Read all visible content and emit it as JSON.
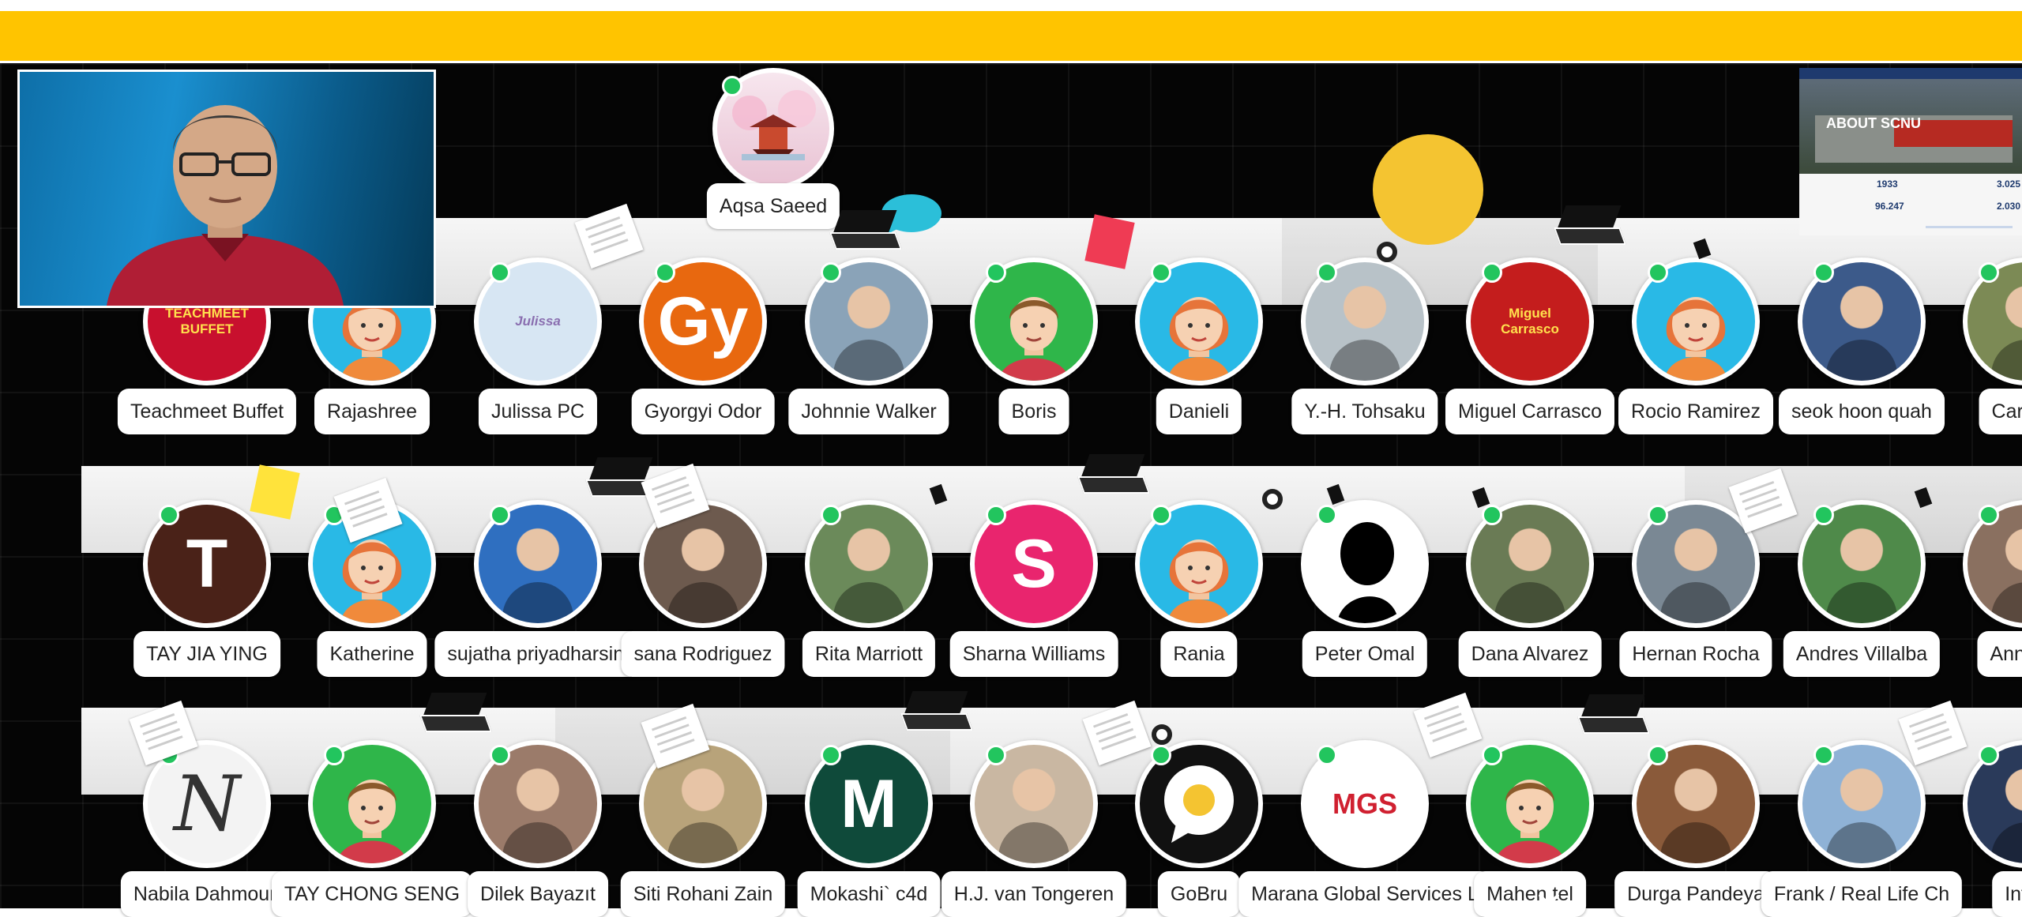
{
  "header": {
    "color": "#ffc400"
  },
  "presenter": {
    "label": "presenter-video"
  },
  "board": {
    "title": "ABOUT SCNU",
    "stats": [
      "1933",
      "3.025",
      "96.247",
      "2.030"
    ]
  },
  "host": {
    "name": "Aqsa Saeed",
    "icon": "pagoda-avatar"
  },
  "rows": [
    {
      "seats": [
        {
          "name": "Teachmeet Buffet",
          "avatar": {
            "type": "logo",
            "text": "TEACHMEET BUFFET",
            "color": "#c8102e"
          }
        },
        {
          "name": "Rajashree",
          "avatar": {
            "type": "girl"
          }
        },
        {
          "name": "Julissa PC",
          "avatar": {
            "type": "illustration",
            "text": "Julissa",
            "color": "#d7e6f3"
          }
        },
        {
          "name": "Gyorgyi Odor",
          "avatar": {
            "type": "initial",
            "text": "Gy",
            "color": "#e8680f"
          }
        },
        {
          "name": "Johnnie Walker",
          "avatar": {
            "type": "photo",
            "color": "#8aa3b8"
          }
        },
        {
          "name": "Boris",
          "avatar": {
            "type": "boy"
          }
        },
        {
          "name": "Danieli",
          "avatar": {
            "type": "girl"
          }
        },
        {
          "name": "Y.-H. Tohsaku",
          "avatar": {
            "type": "photo",
            "color": "#b8c2c8"
          }
        },
        {
          "name": "Miguel Carrasco",
          "avatar": {
            "type": "logo",
            "text": "Miguel Carrasco",
            "color": "#c41d1d"
          }
        },
        {
          "name": "Rocio Ramirez",
          "avatar": {
            "type": "girl"
          }
        },
        {
          "name": "seok hoon quah",
          "avatar": {
            "type": "photo",
            "color": "#3c5a8a"
          }
        },
        {
          "name": "Carmen",
          "avatar": {
            "type": "photo",
            "color": "#7c8a55"
          }
        }
      ]
    },
    {
      "seats": [
        {
          "name": "TAY JIA YING",
          "avatar": {
            "type": "initial",
            "text": "T",
            "color": "#4a2218"
          }
        },
        {
          "name": "Katherine",
          "avatar": {
            "type": "girl"
          }
        },
        {
          "name": "sujatha priyadharsini",
          "avatar": {
            "type": "photo",
            "color": "#2f6fc0"
          }
        },
        {
          "name": "sana Rodriguez",
          "avatar": {
            "type": "photo",
            "color": "#6d5a4e"
          }
        },
        {
          "name": "Rita Marriott",
          "avatar": {
            "type": "photo",
            "color": "#6b8a5a"
          }
        },
        {
          "name": "Sharna Williams",
          "avatar": {
            "type": "initial",
            "text": "S",
            "color": "#e9256e"
          }
        },
        {
          "name": "Rania",
          "avatar": {
            "type": "girl"
          }
        },
        {
          "name": "Peter Omal",
          "avatar": {
            "type": "silhouette"
          }
        },
        {
          "name": "Dana Alvarez",
          "avatar": {
            "type": "photo",
            "color": "#6a7b55"
          }
        },
        {
          "name": "Hernan Rocha",
          "avatar": {
            "type": "photo",
            "color": "#7a8894"
          }
        },
        {
          "name": "Andres Villalba",
          "avatar": {
            "type": "photo",
            "color": "#4f8a4a"
          }
        },
        {
          "name": "Anna Gr",
          "avatar": {
            "type": "photo",
            "color": "#8a7060"
          }
        }
      ]
    },
    {
      "seats": [
        {
          "name": "Nabila Dahmoun",
          "avatar": {
            "type": "letter",
            "text": "N",
            "color": "#f3f3f3"
          }
        },
        {
          "name": "TAY CHONG SENG",
          "avatar": {
            "type": "boy"
          }
        },
        {
          "name": "Dilek Bayazıt",
          "avatar": {
            "type": "photo",
            "color": "#9b7b6a"
          }
        },
        {
          "name": "Siti Rohani Zain",
          "avatar": {
            "type": "photo",
            "color": "#b8a37a"
          }
        },
        {
          "name": "Mokashi` c4d",
          "avatar": {
            "type": "initial",
            "text": "M",
            "color": "#0f4a3a"
          }
        },
        {
          "name": "H.J. van Tongeren",
          "avatar": {
            "type": "photo",
            "color": "#c9b7a2"
          }
        },
        {
          "name": "GoBru",
          "avatar": {
            "type": "egg"
          }
        },
        {
          "name": "Marana Global Services L",
          "avatar": {
            "type": "logo",
            "text": "MGS",
            "color": "#ffffff"
          }
        },
        {
          "name": "Mahen     tel",
          "avatar": {
            "type": "boy"
          }
        },
        {
          "name": "Durga Pandeya",
          "avatar": {
            "type": "photo",
            "color": "#8a5a3a"
          }
        },
        {
          "name": "Frank / Real Life Ch",
          "avatar": {
            "type": "photo",
            "color": "#8fb2d6"
          }
        },
        {
          "name": "Intan",
          "avatar": {
            "type": "photo",
            "color": "#2a3a5a"
          }
        }
      ]
    }
  ]
}
